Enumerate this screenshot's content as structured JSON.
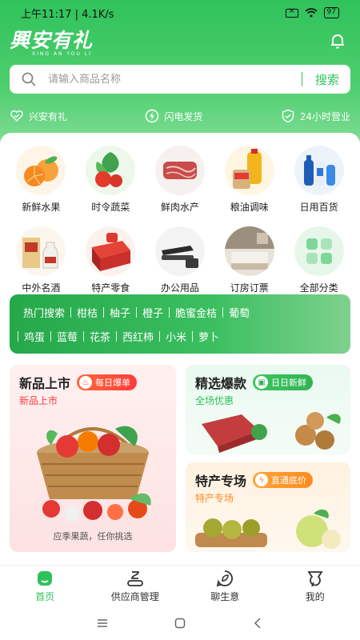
{
  "status": {
    "time_speed": "上午11:17 | 4.1K/s",
    "battery": "97"
  },
  "app": {
    "logo_title": "興安有礼",
    "logo_sub": "XING AN YOU LI"
  },
  "search": {
    "placeholder": "请输入商品名称",
    "button": "搜索"
  },
  "features": [
    {
      "label": "兴安有礼",
      "icon": "heart-check-icon"
    },
    {
      "label": "闪电发货",
      "icon": "lightning-icon"
    },
    {
      "label": "24小时营业",
      "icon": "shield-check-icon"
    }
  ],
  "categories": [
    {
      "label": "新鲜水果",
      "icon": "fruit-icon"
    },
    {
      "label": "时令蔬菜",
      "icon": "vegetable-icon"
    },
    {
      "label": "鲜肉水产",
      "icon": "meat-icon"
    },
    {
      "label": "粮油调味",
      "icon": "oil-icon"
    },
    {
      "label": "日用百货",
      "icon": "daily-goods-icon"
    },
    {
      "label": "中外名酒",
      "icon": "liquor-icon"
    },
    {
      "label": "特产零食",
      "icon": "snack-icon"
    },
    {
      "label": "办公用品",
      "icon": "stapler-icon"
    },
    {
      "label": "订房订票",
      "icon": "hotel-room-icon"
    },
    {
      "label": "全部分类",
      "icon": "all-categories-icon"
    }
  ],
  "hot_search": {
    "title": "热门搜索",
    "row1": [
      "柑桔",
      "柚子",
      "橙子",
      "脆蜜金桔",
      "葡萄"
    ],
    "row2": [
      "鸡蛋",
      "蓝莓",
      "花茶",
      "西红柿",
      "小米",
      "萝卜"
    ]
  },
  "promos": {
    "new": {
      "title": "新品上市",
      "badge": "每日爆单",
      "subtitle": "新品上市",
      "caption": "应季果蔬，任你挑选"
    },
    "pick": {
      "title": "精选爆款",
      "badge": "日日新鲜",
      "subtitle": "全场优惠"
    },
    "special": {
      "title": "特产专场",
      "badge": "直通底价",
      "subtitle": "特产专场"
    }
  },
  "tabs": [
    {
      "label": "首页",
      "active": true
    },
    {
      "label": "供应商管理",
      "active": false
    },
    {
      "label": "聊生意",
      "active": false
    },
    {
      "label": "我的",
      "active": false
    }
  ],
  "colors": {
    "brand": "#2fc25b",
    "promo_red": "#ff3b3b",
    "promo_orange": "#ff8a1f"
  }
}
